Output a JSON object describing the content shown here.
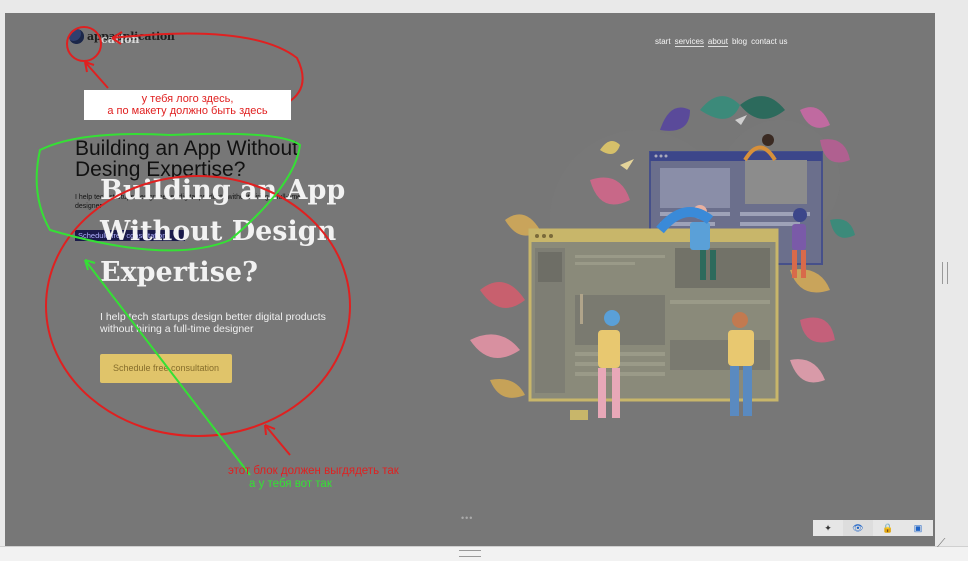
{
  "logo": {
    "text": "appapplication",
    "text_overlay": "cation"
  },
  "nav": {
    "items": [
      "start",
      "services",
      "about",
      "blog",
      "contact us"
    ],
    "overlay_text": "blog contact us"
  },
  "small_hero": {
    "title": "Building an App Without Desing Expertise?",
    "subtitle": "I help tech startups design better digital products without hiring a full-time designer",
    "button": "Schedule free consultation"
  },
  "big_hero": {
    "title": "Building an App Without Design Expertise?",
    "subtitle": "I help tech startups design better digital products without hiring a full-time designer",
    "button": "Schedule free consultation"
  },
  "annotations": {
    "logo_note_line1": "у тебя лого здесь,",
    "logo_note_line2": "а по макету должно быть здесь",
    "block_note_red": "этот блок должен выгдядеть так",
    "block_note_green": "а у тебя вот так"
  },
  "toolbar": {
    "icons": [
      "plus-icon",
      "eye-icon",
      "lock-icon",
      "box-icon"
    ]
  },
  "colors": {
    "overlay_bg": "#777777",
    "annotation_red": "#e02020",
    "annotation_green": "#35e035",
    "button_yellow": "#e0c46a"
  }
}
